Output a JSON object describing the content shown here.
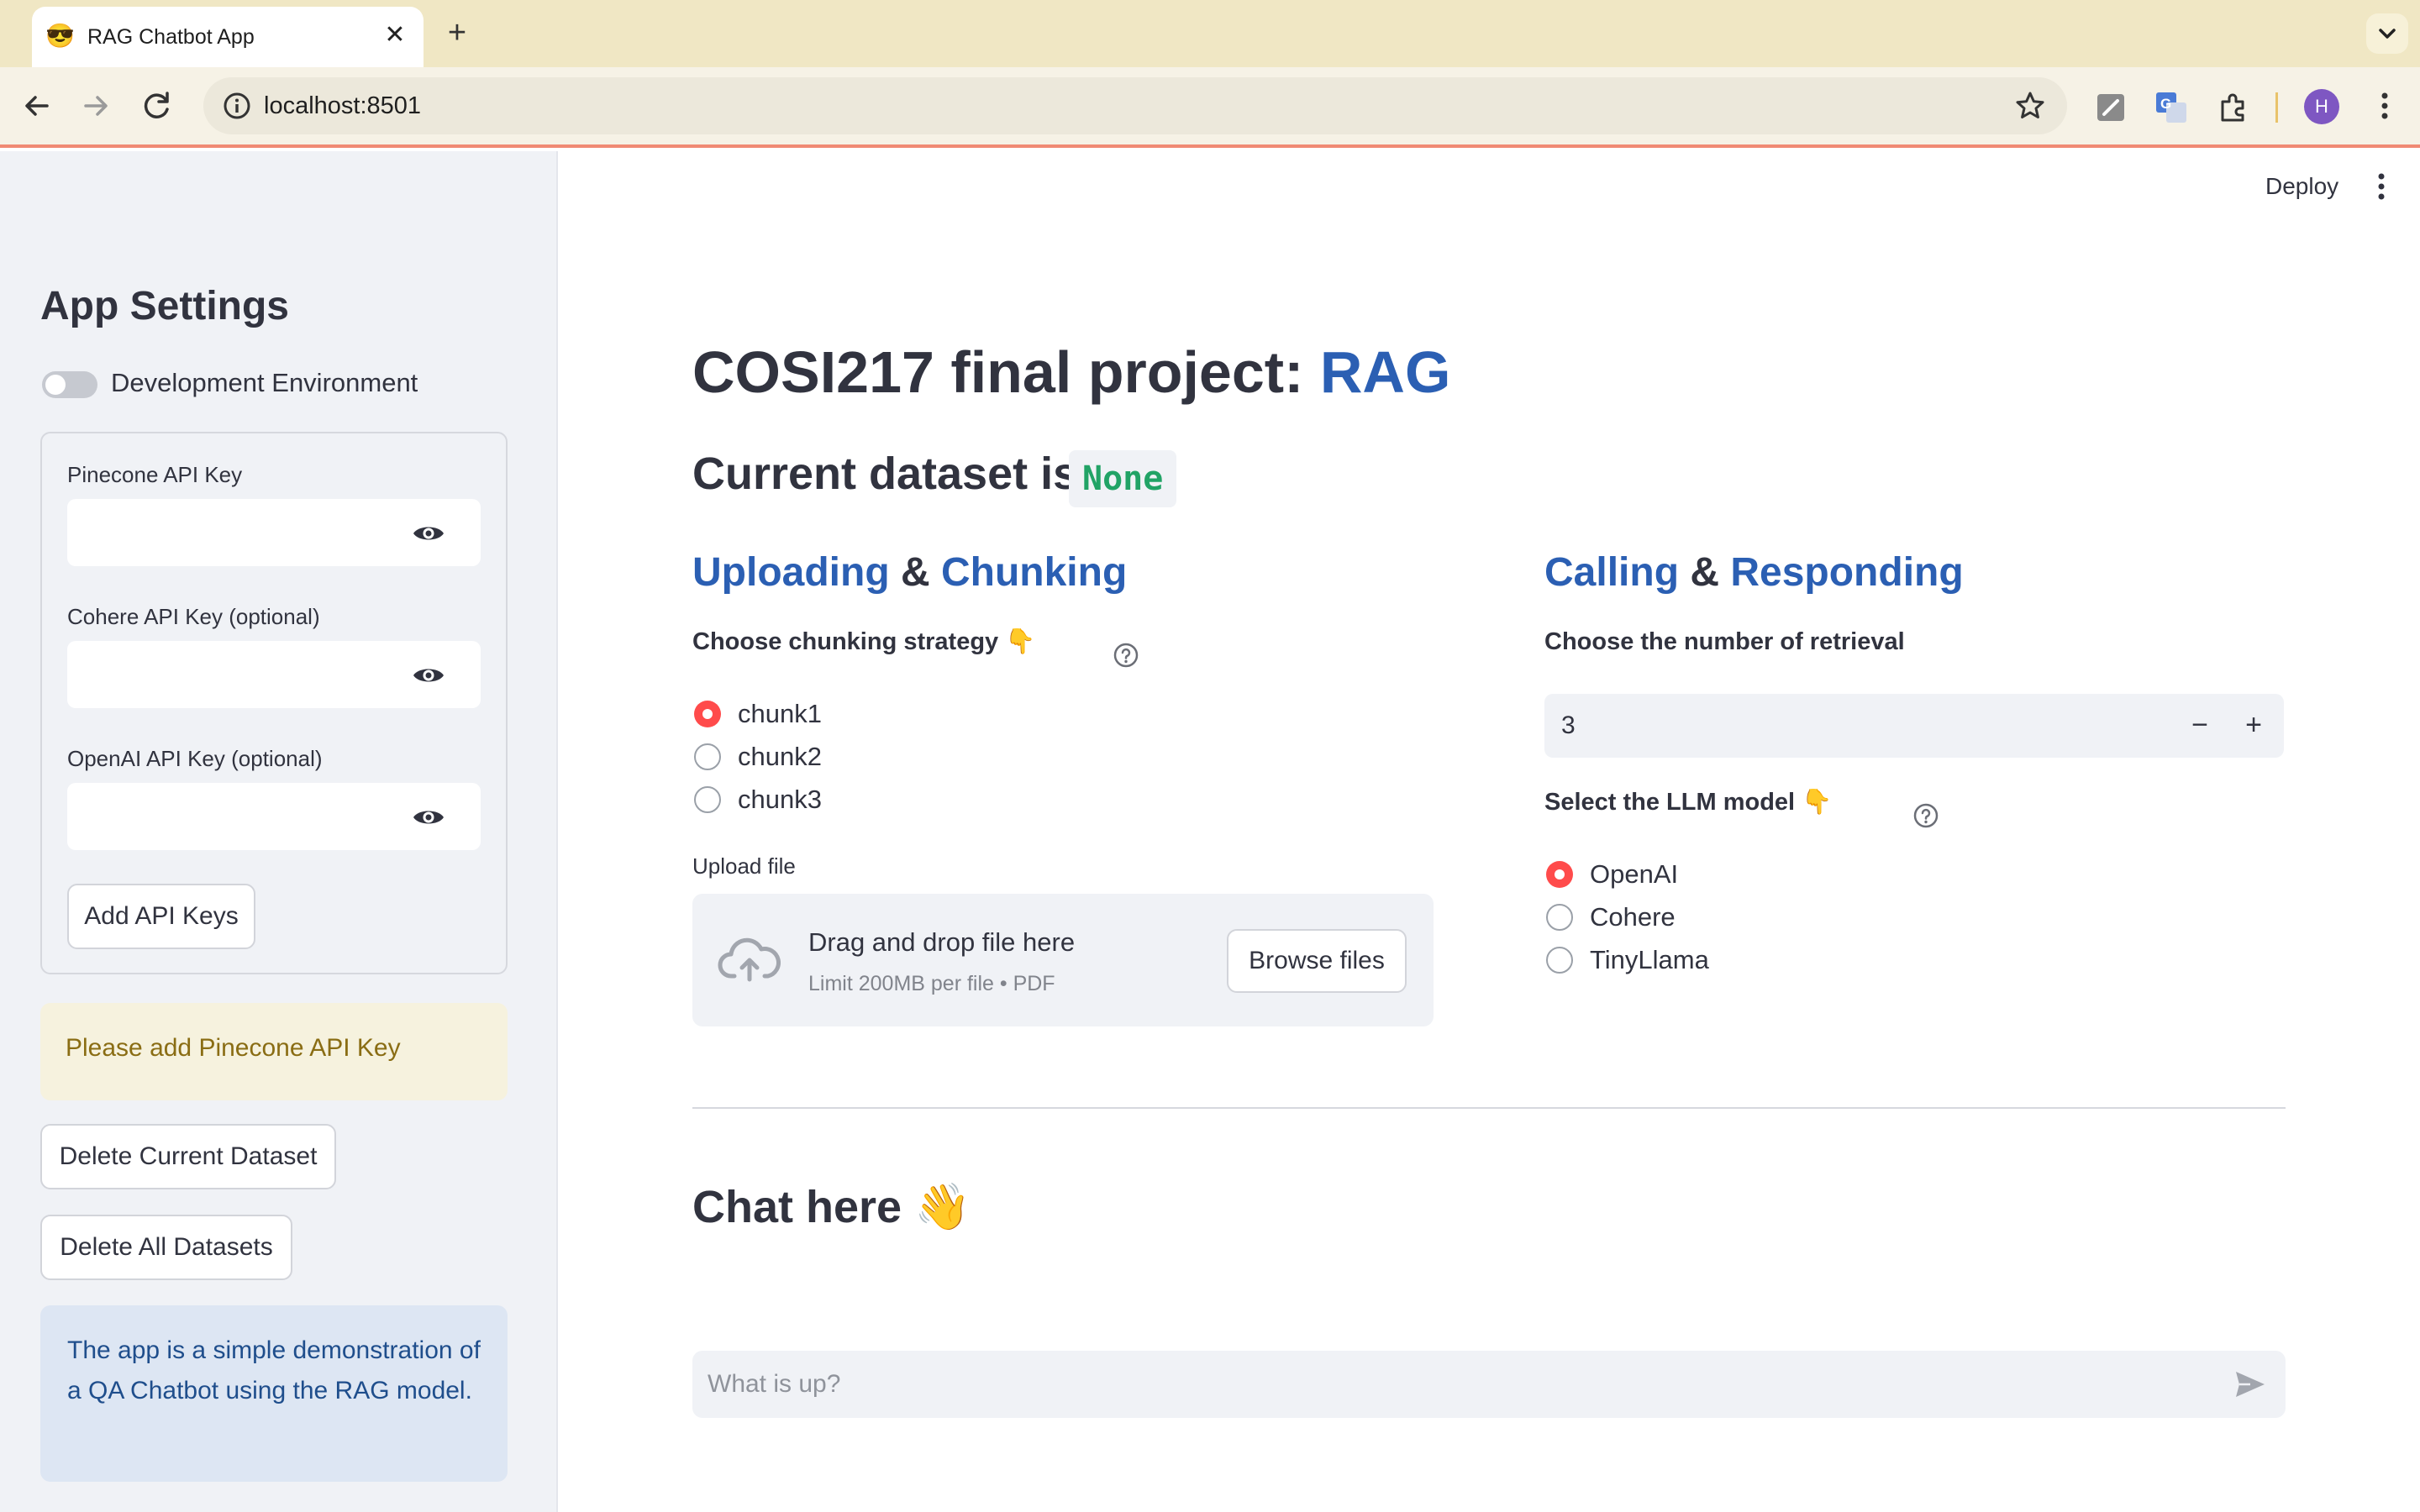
{
  "browser": {
    "tab_emoji": "😎",
    "tab_title": "RAG Chatbot App",
    "tab_close": "✕",
    "new_tab": "+",
    "url": "localhost:8501",
    "profile_initial": "H"
  },
  "sidebar": {
    "title": "App Settings",
    "dev_toggle_label": "Development Environment",
    "dev_toggle_on": false,
    "fields": [
      {
        "label": "Pinecone API Key",
        "value": ""
      },
      {
        "label": "Cohere API Key (optional)",
        "value": ""
      },
      {
        "label": "OpenAI API Key (optional)",
        "value": ""
      }
    ],
    "add_keys_button": "Add API Keys",
    "warning": "Please add Pinecone API Key",
    "delete_current_button": "Delete Current Dataset",
    "delete_all_button": "Delete All Datasets",
    "info": "The app is a simple demonstration of a QA Chatbot using the RAG model."
  },
  "header": {
    "deploy_label": "Deploy"
  },
  "main": {
    "title_prefix": "COSI217 final project: ",
    "title_accent": "RAG",
    "dataset_label": "Current dataset is:",
    "dataset_value": "None",
    "upload_section": {
      "heading_part1": "Uploading",
      "amp": " & ",
      "heading_part2": "Chunking",
      "strategy_label": "Choose chunking strategy 👇",
      "options": [
        "chunk1",
        "chunk2",
        "chunk3"
      ],
      "selected": "chunk1",
      "upload_label": "Upload file",
      "drop_title": "Drag and drop file here",
      "drop_sub": "Limit 200MB per file • PDF",
      "browse_button": "Browse files"
    },
    "calling_section": {
      "heading_part1": "Calling",
      "amp": " & ",
      "heading_part2": "Responding",
      "retrieval_label": "Choose the number of retrieval",
      "retrieval_value": "3",
      "minus": "−",
      "plus": "+",
      "model_label": "Select the LLM model 👇",
      "options": [
        "OpenAI",
        "Cohere",
        "TinyLlama"
      ],
      "selected": "OpenAI"
    },
    "chat_heading": "Chat here 👋",
    "chat_placeholder": "What is up?"
  },
  "colors": {
    "accent_blue": "#2b5fb3",
    "radio_selected": "#ff4b4b",
    "code_green": "#21a366",
    "sidebar_bg": "#f0f2f6",
    "tabstrip_bg": "#f0e7c4"
  }
}
